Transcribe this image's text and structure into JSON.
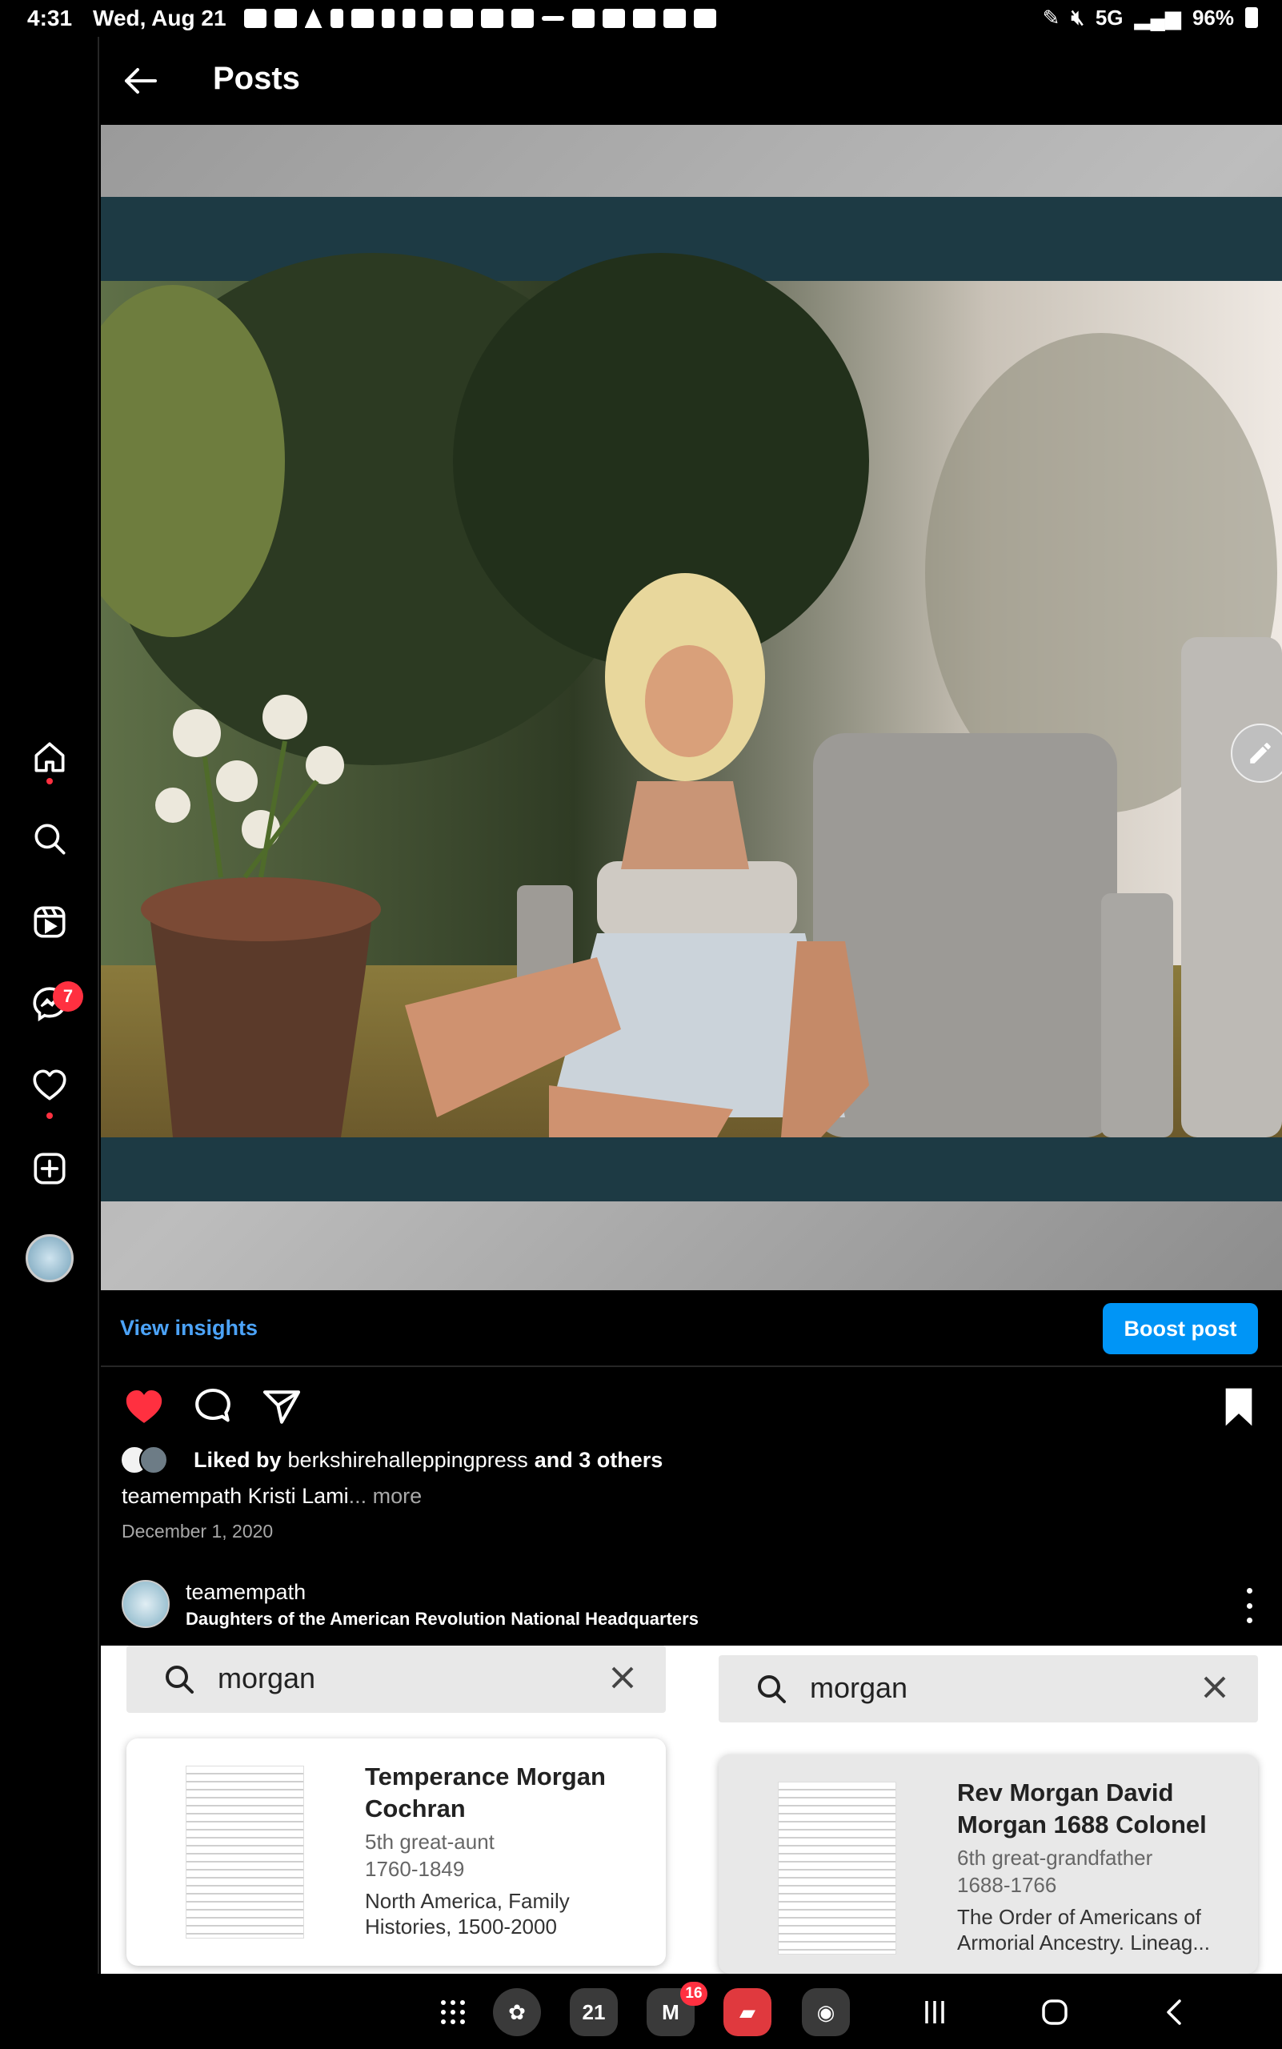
{
  "status_bar": {
    "time": "4:31",
    "date": "Wed, Aug 21",
    "network": "5G",
    "battery": "96%"
  },
  "nav_rail": {
    "items": [
      {
        "icon": "home-icon"
      },
      {
        "icon": "search-icon"
      },
      {
        "icon": "reels-icon"
      },
      {
        "icon": "messenger-icon",
        "badge": "7"
      },
      {
        "icon": "heart-icon"
      },
      {
        "icon": "create-icon"
      },
      {
        "icon": "profile-avatar"
      }
    ]
  },
  "header": {
    "title": "Posts"
  },
  "post": {
    "insights_label": "View insights",
    "boost_label": "Boost post",
    "liked_by_prefix": "Liked by",
    "liked_by_account": "berkshirehalleppingpress",
    "liked_by_suffix": "and 3 others",
    "caption_user": "teamempath",
    "caption_text": "Kristi Lami",
    "caption_more": "... more",
    "date": "December 1, 2020"
  },
  "next_post": {
    "author": "teamempath",
    "location": "Daughters of the American Revolution National Headquarters",
    "left_panel": {
      "search_query": "morgan",
      "result_name_line1": "Temperance Morgan",
      "result_name_line2": "Cochran",
      "relation": "5th great-aunt",
      "years": "1760-1849",
      "source_line1": "North America, Family",
      "source_line2": "Histories, 1500-2000"
    },
    "right_panel": {
      "search_query": "morgan",
      "result_name_line1": "Rev Morgan David",
      "result_name_line2": "Morgan 1688 Colonel",
      "relation": "6th great-grandfather",
      "years": "1688-1766",
      "source_line1": "The Order of Americans of",
      "source_line2": "Armorial Ancestry. Lineag..."
    }
  },
  "android_nav": {
    "calendar_day": "21",
    "gmail_badge": "16"
  },
  "colors": {
    "accent_blue": "#0095f6",
    "link_blue": "#4ca3f8",
    "like_red": "#ff3040",
    "background": "#000000"
  }
}
